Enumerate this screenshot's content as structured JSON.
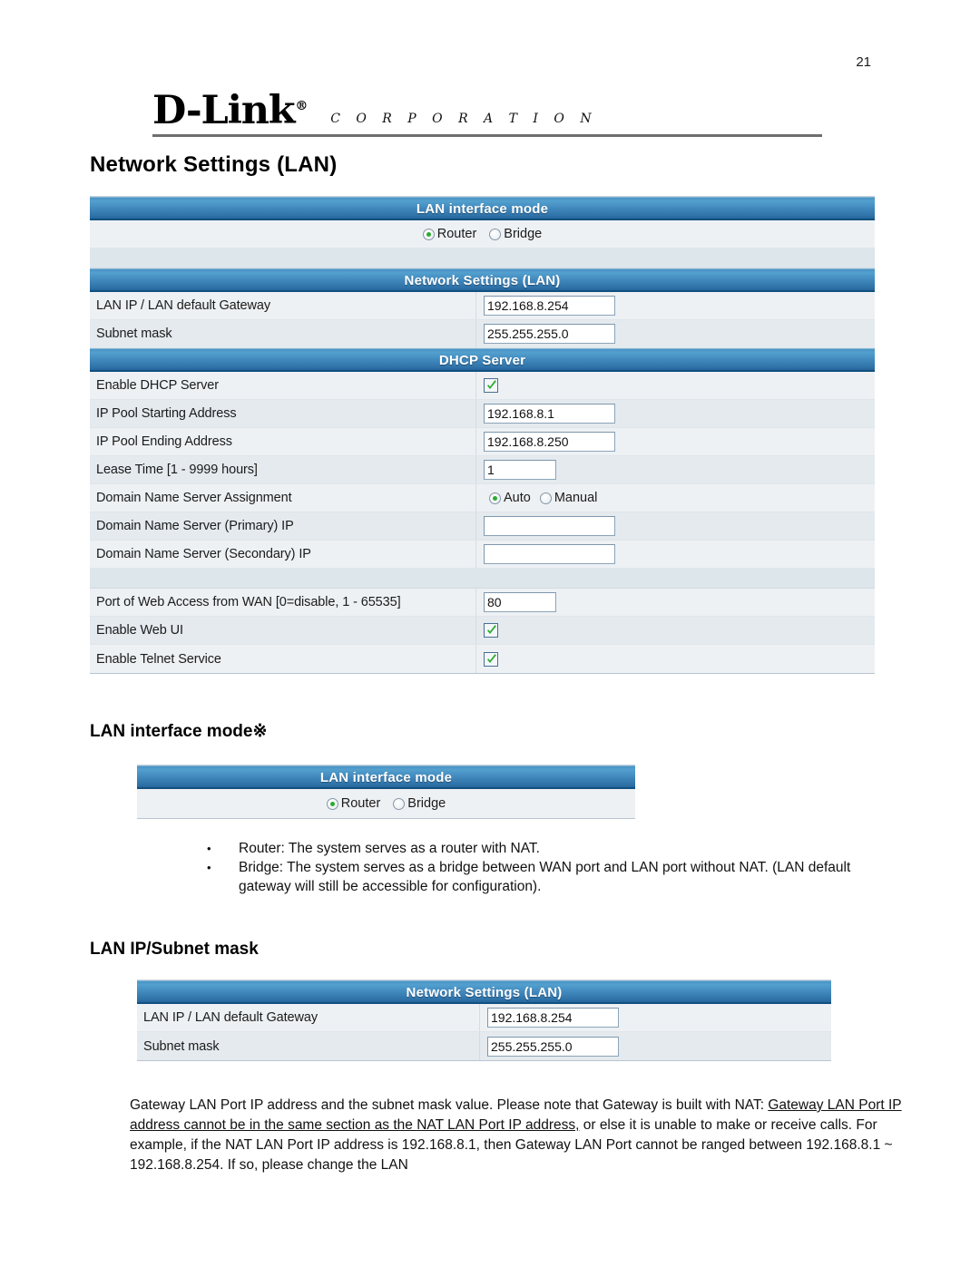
{
  "page": {
    "number": "21",
    "brand": {
      "logo": "D-Link",
      "registered": "®",
      "corporation": "C O R P O R A T I O N"
    },
    "title": "Network Settings (LAN)"
  },
  "screenshot_main": {
    "lan_interface_mode": {
      "bar": "LAN interface mode",
      "options": [
        {
          "label": "Router",
          "selected": true
        },
        {
          "label": "Bridge",
          "selected": false
        }
      ]
    },
    "network_settings_lan": {
      "bar": "Network Settings (LAN)",
      "rows": [
        {
          "label": "LAN IP / LAN default Gateway",
          "value": "192.168.8.254"
        },
        {
          "label": "Subnet mask",
          "value": "255.255.255.0"
        }
      ]
    },
    "dhcp_server": {
      "bar": "DHCP Server",
      "enable_label": "Enable DHCP Server",
      "enable_checked": true,
      "pool_start_label": "IP Pool Starting Address",
      "pool_start_value": "192.168.8.1",
      "pool_end_label": "IP Pool Ending Address",
      "pool_end_value": "192.168.8.250",
      "lease_label": "Lease Time [1 - 9999 hours]",
      "lease_value": "1",
      "dns_assignment_label": "Domain Name Server Assignment",
      "dns_assignment_options": [
        {
          "label": "Auto",
          "selected": true
        },
        {
          "label": "Manual",
          "selected": false
        }
      ],
      "dns_primary_label": "Domain Name Server (Primary) IP",
      "dns_primary_value": "",
      "dns_secondary_label": "Domain Name Server (Secondary) IP",
      "dns_secondary_value": ""
    },
    "web_access": {
      "port_label": "Port of Web Access from WAN [0=disable, 1 - 65535]",
      "port_value": "80",
      "web_ui_label": "Enable Web UI",
      "web_ui_checked": true,
      "telnet_label": "Enable Telnet Service",
      "telnet_checked": true
    }
  },
  "section_lan_interface_mode": {
    "heading": "LAN interface mode※",
    "screenshot": {
      "bar": "LAN interface mode",
      "options": [
        {
          "label": "Router",
          "selected": true
        },
        {
          "label": "Bridge",
          "selected": false
        }
      ]
    },
    "bullets": [
      {
        "marker": "•",
        "text": "Router: The system serves as a router with NAT."
      },
      {
        "marker": "•",
        "text": "Bridge: The system serves as a bridge between WAN port and LAN port without NAT. (LAN default gateway will still be accessible for configuration)."
      }
    ]
  },
  "section_lan_ip_subnet": {
    "heading": "LAN IP/Subnet mask",
    "screenshot": {
      "bar": "Network Settings (LAN)",
      "rows": [
        {
          "label": "LAN IP / LAN default Gateway",
          "value": "192.168.8.254"
        },
        {
          "label": "Subnet mask",
          "value": "255.255.255.0"
        }
      ]
    },
    "paragraph": {
      "line1": "Gateway LAN Port IP address and the subnet mask value. Please note that Gateway is built with NAT:",
      "underlined": "Gateway LAN Port IP address cannot be in the same section as the NAT LAN Port IP address,",
      "rest": " or else it is unable to make or receive calls.   For example, if the NAT LAN Port IP address is 192.168.8.1, then Gateway LAN Port cannot be ranged between 192.168.8.1 ~ 192.168.8.254. If so, please change the LAN"
    }
  },
  "colors": {
    "bar_blue": "#3f86bb",
    "bar_blue_dark": "#12507f",
    "row_bg": "#eef1f4",
    "row_bg_alt": "#e4eaee",
    "check_green": "#2faa2f",
    "rule_gray": "#6e6e6e"
  }
}
